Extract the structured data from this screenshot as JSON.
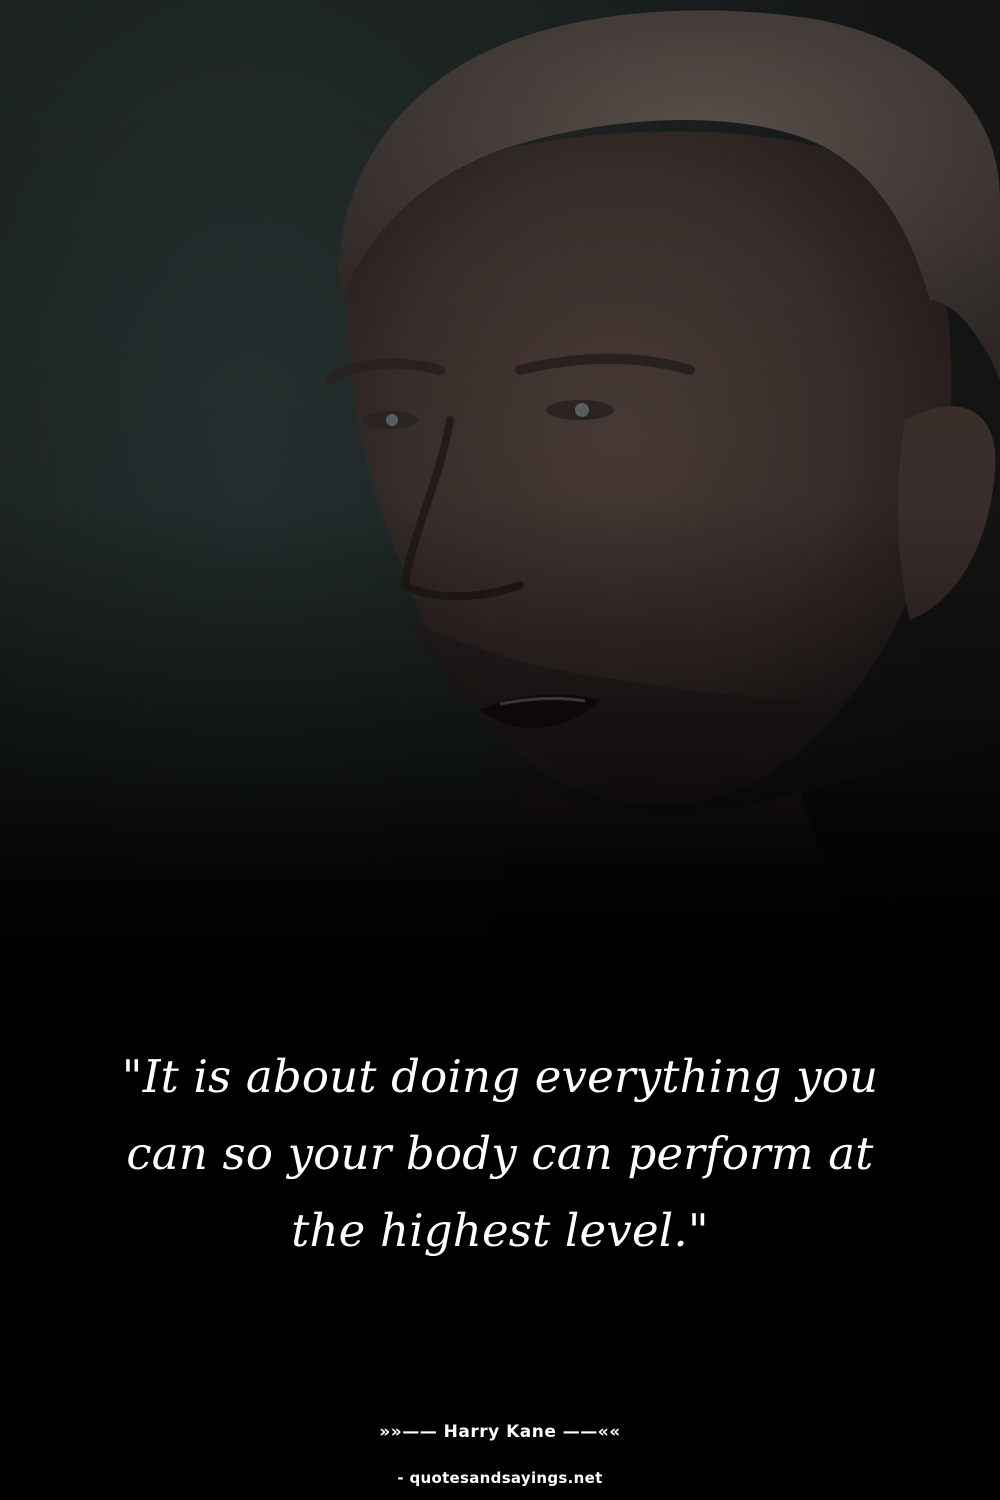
{
  "quote": {
    "text": "\"It is about doing everything you can so your body can perform at the highest level.\""
  },
  "author": {
    "line": "»»—— Harry Kane ——««"
  },
  "source": {
    "watermark": "- quotesandsayings.net"
  },
  "colors": {
    "background_top": "#1c1f1f",
    "background_bottom": "#000000",
    "text": "#ffffff",
    "skin_shadow": "#3a2e2b",
    "hair": "#4a403c"
  }
}
